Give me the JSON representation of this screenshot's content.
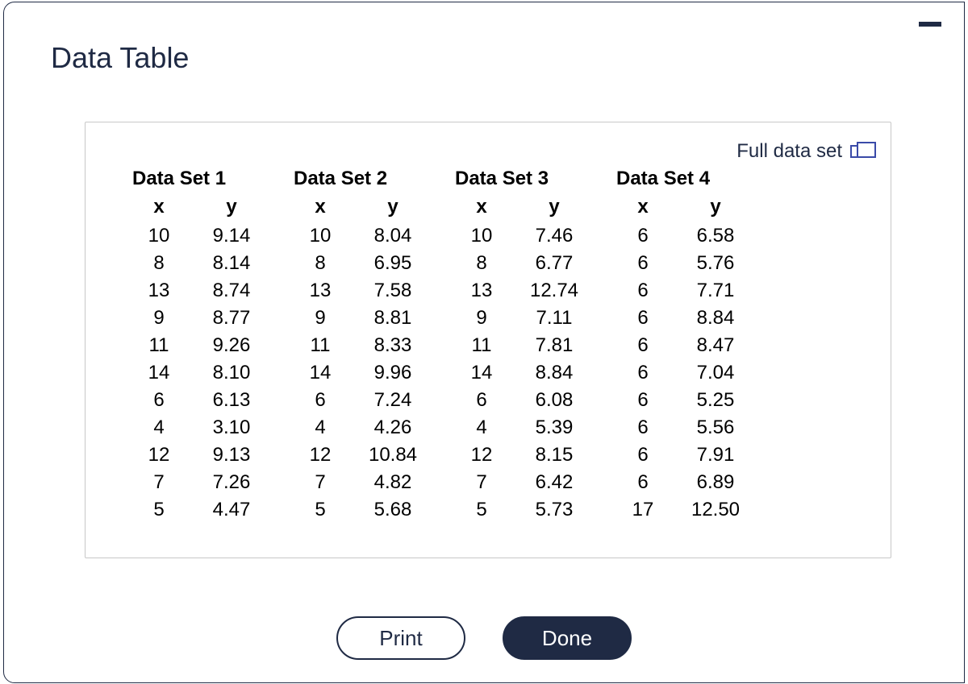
{
  "title": "Data Table",
  "full_link_label": "Full data set",
  "print_label": "Print",
  "done_label": "Done",
  "col_headers": {
    "x": "x",
    "y": "y"
  },
  "datasets": [
    {
      "title": "Data Set 1",
      "x": [
        10,
        8,
        13,
        9,
        11,
        14,
        6,
        4,
        12,
        7,
        5
      ],
      "y": [
        9.14,
        8.14,
        8.74,
        8.77,
        9.26,
        8.1,
        6.13,
        3.1,
        9.13,
        7.26,
        4.47
      ]
    },
    {
      "title": "Data Set 2",
      "x": [
        10,
        8,
        13,
        9,
        11,
        14,
        6,
        4,
        12,
        7,
        5
      ],
      "y": [
        8.04,
        6.95,
        7.58,
        8.81,
        8.33,
        9.96,
        7.24,
        4.26,
        10.84,
        4.82,
        5.68
      ]
    },
    {
      "title": "Data Set 3",
      "x": [
        10,
        8,
        13,
        9,
        11,
        14,
        6,
        4,
        12,
        7,
        5
      ],
      "y": [
        7.46,
        6.77,
        12.74,
        7.11,
        7.81,
        8.84,
        6.08,
        5.39,
        8.15,
        6.42,
        5.73
      ]
    },
    {
      "title": "Data Set 4",
      "x": [
        6,
        6,
        6,
        6,
        6,
        6,
        6,
        6,
        6,
        6,
        17
      ],
      "y": [
        6.58,
        5.76,
        7.71,
        8.84,
        8.47,
        7.04,
        5.25,
        5.56,
        7.91,
        6.89,
        12.5
      ]
    }
  ],
  "chart_data": [
    {
      "type": "table",
      "title": "Data Set 1",
      "x": [
        10,
        8,
        13,
        9,
        11,
        14,
        6,
        4,
        12,
        7,
        5
      ],
      "y": [
        9.14,
        8.14,
        8.74,
        8.77,
        9.26,
        8.1,
        6.13,
        3.1,
        9.13,
        7.26,
        4.47
      ]
    },
    {
      "type": "table",
      "title": "Data Set 2",
      "x": [
        10,
        8,
        13,
        9,
        11,
        14,
        6,
        4,
        12,
        7,
        5
      ],
      "y": [
        8.04,
        6.95,
        7.58,
        8.81,
        8.33,
        9.96,
        7.24,
        4.26,
        10.84,
        4.82,
        5.68
      ]
    },
    {
      "type": "table",
      "title": "Data Set 3",
      "x": [
        10,
        8,
        13,
        9,
        11,
        14,
        6,
        4,
        12,
        7,
        5
      ],
      "y": [
        7.46,
        6.77,
        12.74,
        7.11,
        7.81,
        8.84,
        6.08,
        5.39,
        8.15,
        6.42,
        5.73
      ]
    },
    {
      "type": "table",
      "title": "Data Set 4",
      "x": [
        6,
        6,
        6,
        6,
        6,
        6,
        6,
        6,
        6,
        6,
        17
      ],
      "y": [
        6.58,
        5.76,
        7.71,
        8.84,
        8.47,
        7.04,
        5.25,
        5.56,
        7.91,
        6.89,
        12.5
      ]
    }
  ]
}
